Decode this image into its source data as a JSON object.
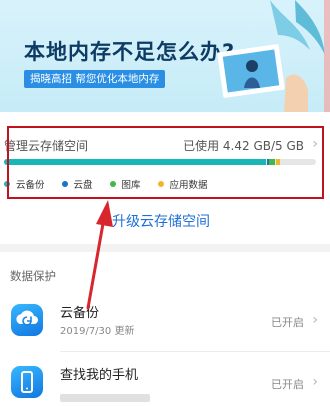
{
  "banner": {
    "title": "本地内存不足怎么办?",
    "tag": "揭晓高招 帮您优化本地内存"
  },
  "storage": {
    "label": "管理云存储空间",
    "used": "已使用 4.42 GB/5 GB",
    "used_fraction": 0.884,
    "segments": [
      {
        "name": "云备份",
        "color": "#1ab5b5",
        "fraction": 0.84
      },
      {
        "name": "云盘",
        "color": "#1a73c9",
        "fraction": 0.004
      },
      {
        "name": "图库",
        "color": "#43b84a",
        "fraction": 0.02
      },
      {
        "name": "应用数据",
        "color": "#f0b528",
        "fraction": 0.012
      }
    ],
    "legend": [
      "云备份",
      "云盘",
      "图库",
      "应用数据"
    ]
  },
  "upgrade_label": "升级云存储空间",
  "section_title": "数据保护",
  "rows": [
    {
      "title": "云备份",
      "subtitle": "2019/7/30 更新",
      "status": "已开启",
      "icon": "cloud-backup-icon"
    },
    {
      "title": "查找我的手机",
      "subtitle": "",
      "status": "已开启",
      "icon": "phone-icon"
    }
  ],
  "chevron": "›"
}
